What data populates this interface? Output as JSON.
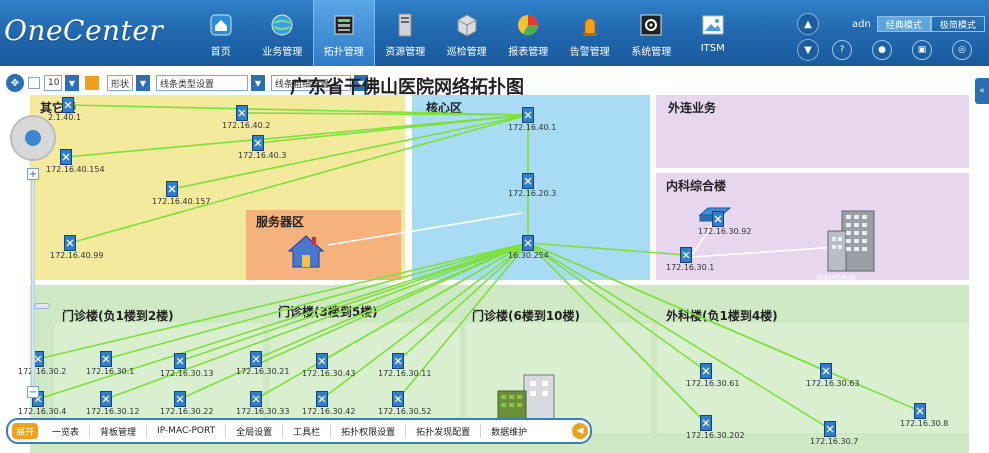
{
  "header": {
    "logo": "OneCenter",
    "nav": [
      {
        "label": "首页",
        "icon": "home-icon"
      },
      {
        "label": "业务管理",
        "icon": "globe-icon"
      },
      {
        "label": "拓扑管理",
        "icon": "topology-icon",
        "active": true
      },
      {
        "label": "资源管理",
        "icon": "server-icon"
      },
      {
        "label": "巡检管理",
        "icon": "box-icon"
      },
      {
        "label": "报表管理",
        "icon": "pie-chart-icon"
      },
      {
        "label": "告警管理",
        "icon": "alarm-icon"
      },
      {
        "label": "系统管理",
        "icon": "gear-icon"
      },
      {
        "label": "ITSM",
        "icon": "picture-icon"
      }
    ],
    "username": "adn",
    "mode_classic": "经典模式",
    "mode_simple": "极简模式"
  },
  "toolbar": {
    "zoom_value": "10",
    "shape_label": "形状",
    "line_type_label": "线条类型设置",
    "line_width_label": "线条粗细设置"
  },
  "map": {
    "title": "广东省干佛山医院网络拓扑图",
    "zones": [
      {
        "id": "other",
        "label": "其它楼"
      },
      {
        "id": "core",
        "label": "核心区"
      },
      {
        "id": "external",
        "label": "外连业务"
      },
      {
        "id": "internal",
        "label": "内科综合楼"
      },
      {
        "id": "server",
        "label": "服务器区"
      },
      {
        "id": "outpatient1",
        "label": "门诊楼(负1楼到2楼)"
      },
      {
        "id": "outpatient2",
        "label": "门诊楼(3楼到5楼)"
      },
      {
        "id": "outpatient3",
        "label": "门诊楼(6楼到10楼)"
      },
      {
        "id": "surgery",
        "label": "外科楼(负1楼到4楼)"
      }
    ],
    "nodes": [
      {
        "id": "n1",
        "label": "2.1.40.1"
      },
      {
        "id": "n2",
        "label": "172.16.40.2"
      },
      {
        "id": "n3",
        "label": "172.16.40.3"
      },
      {
        "id": "n4",
        "label": "172.16.40.154"
      },
      {
        "id": "n5",
        "label": "172.16.40.157"
      },
      {
        "id": "n6",
        "label": "172.16.40.99"
      },
      {
        "id": "c1",
        "label": "172.16.40.1"
      },
      {
        "id": "c2",
        "label": "172.16.20.3"
      },
      {
        "id": "c3",
        "label": "16.30.254"
      },
      {
        "id": "i1",
        "label": "172.16.30.1"
      },
      {
        "id": "i2",
        "label": "172.16.30.92"
      },
      {
        "id": "o1",
        "label": "172.16.30.2"
      },
      {
        "id": "o2",
        "label": "172.16.30.1"
      },
      {
        "id": "o3",
        "label": "172.16.30.13"
      },
      {
        "id": "o4",
        "label": "172.16.30.21"
      },
      {
        "id": "o5",
        "label": "172.16.30.43"
      },
      {
        "id": "o6",
        "label": "172.16.30.11"
      },
      {
        "id": "o7",
        "label": "172.16.30.4"
      },
      {
        "id": "o8",
        "label": "172.16.30.12"
      },
      {
        "id": "o9",
        "label": "172.16.30.22"
      },
      {
        "id": "o10",
        "label": "172.16.30.33"
      },
      {
        "id": "o11",
        "label": "172.16.30.42"
      },
      {
        "id": "o12",
        "label": "172.16.30.52"
      },
      {
        "id": "s1",
        "label": "172.16.30.61"
      },
      {
        "id": "s2",
        "label": "172.16.30.63"
      },
      {
        "id": "s3",
        "label": "172.16.30.202"
      },
      {
        "id": "s4",
        "label": "172.16.30.7"
      },
      {
        "id": "s5",
        "label": "172.16.30.8"
      }
    ],
    "building_label": "内科综合楼"
  },
  "bottom_bar": {
    "tag": "展开",
    "items": [
      "一览表",
      "背板管理",
      "IP-MAC-PORT",
      "全局设置",
      "工具栏",
      "拓扑权限设置",
      "拓扑发现配置",
      "数据维护"
    ]
  },
  "colors": {
    "header": "#1f66ad",
    "edge": "#7ee03a",
    "zone_yellow": "#f3ea9e",
    "zone_blue": "#a8dcf5",
    "zone_purple": "#e8d6ef",
    "zone_green": "#cfe9c4",
    "zone_orange": "#f5b27c"
  }
}
